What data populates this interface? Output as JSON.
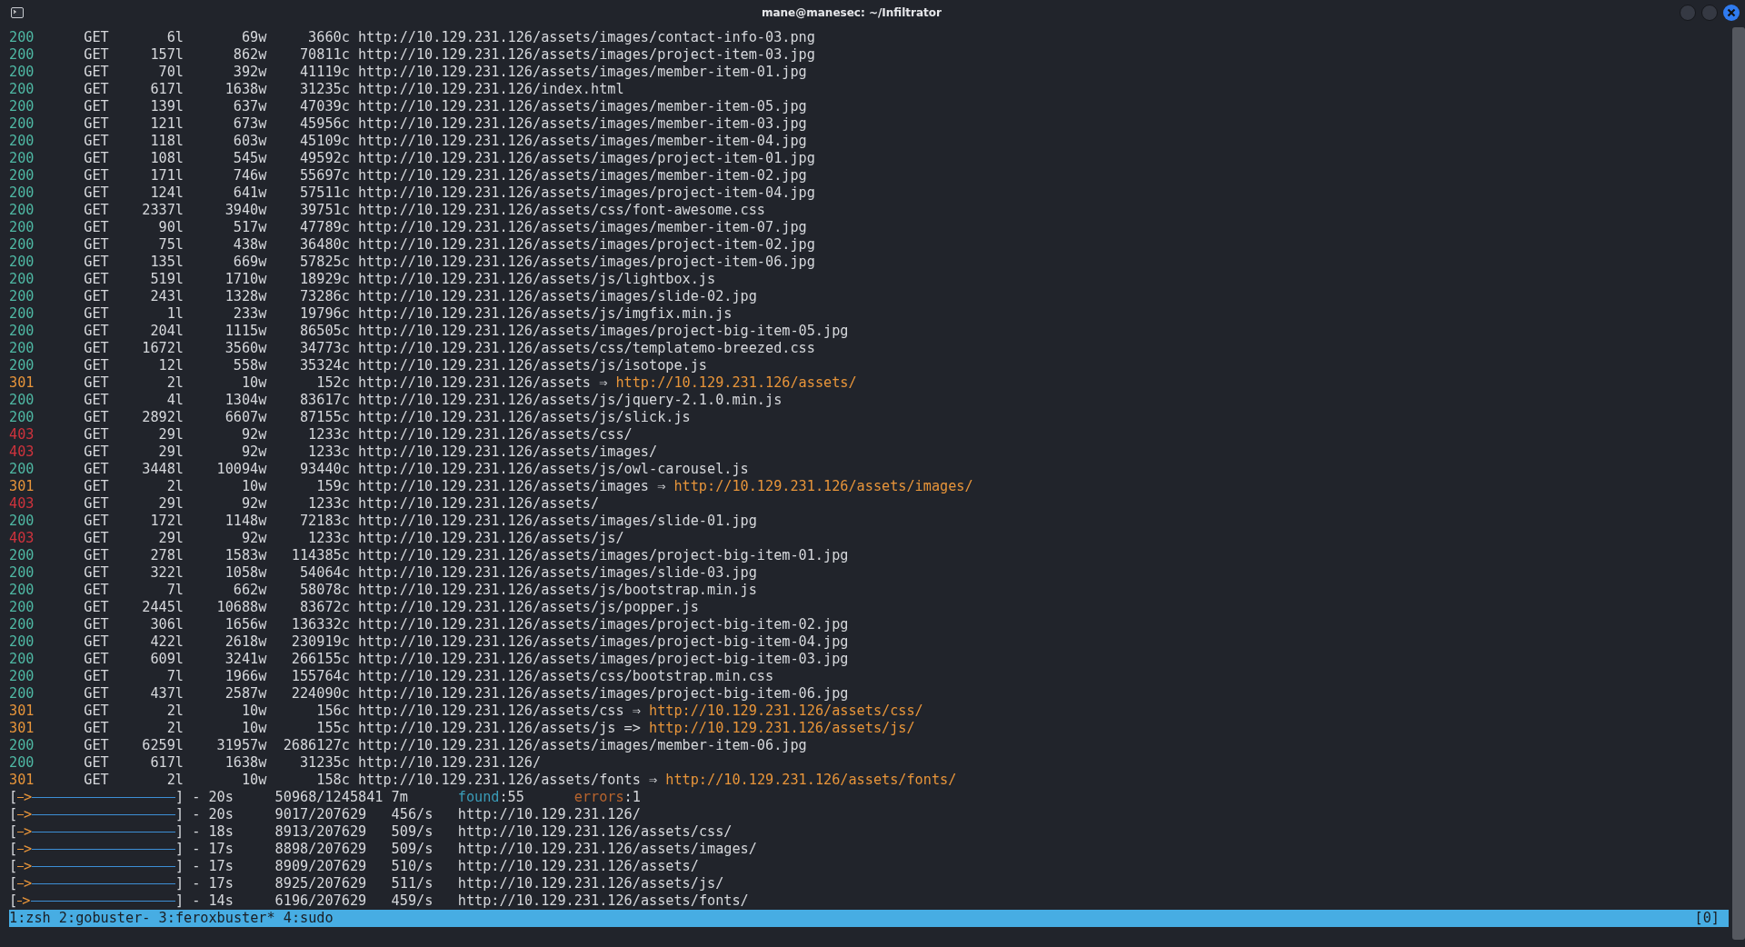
{
  "window": {
    "title": "mane@manesec: ~/Infiltrator"
  },
  "results": [
    {
      "kind": "ok",
      "status": "200",
      "method": "GET",
      "lines": "6l",
      "words": "69w",
      "chars": "3660c",
      "url": "http://10.129.231.126/assets/images/contact-info-03.png"
    },
    {
      "kind": "ok",
      "status": "200",
      "method": "GET",
      "lines": "157l",
      "words": "862w",
      "chars": "70811c",
      "url": "http://10.129.231.126/assets/images/project-item-03.jpg"
    },
    {
      "kind": "ok",
      "status": "200",
      "method": "GET",
      "lines": "70l",
      "words": "392w",
      "chars": "41119c",
      "url": "http://10.129.231.126/assets/images/member-item-01.jpg"
    },
    {
      "kind": "ok",
      "status": "200",
      "method": "GET",
      "lines": "617l",
      "words": "1638w",
      "chars": "31235c",
      "url": "http://10.129.231.126/index.html"
    },
    {
      "kind": "ok",
      "status": "200",
      "method": "GET",
      "lines": "139l",
      "words": "637w",
      "chars": "47039c",
      "url": "http://10.129.231.126/assets/images/member-item-05.jpg"
    },
    {
      "kind": "ok",
      "status": "200",
      "method": "GET",
      "lines": "121l",
      "words": "673w",
      "chars": "45956c",
      "url": "http://10.129.231.126/assets/images/member-item-03.jpg"
    },
    {
      "kind": "ok",
      "status": "200",
      "method": "GET",
      "lines": "118l",
      "words": "603w",
      "chars": "45109c",
      "url": "http://10.129.231.126/assets/images/member-item-04.jpg"
    },
    {
      "kind": "ok",
      "status": "200",
      "method": "GET",
      "lines": "108l",
      "words": "545w",
      "chars": "49592c",
      "url": "http://10.129.231.126/assets/images/project-item-01.jpg"
    },
    {
      "kind": "ok",
      "status": "200",
      "method": "GET",
      "lines": "171l",
      "words": "746w",
      "chars": "55697c",
      "url": "http://10.129.231.126/assets/images/member-item-02.jpg"
    },
    {
      "kind": "ok",
      "status": "200",
      "method": "GET",
      "lines": "124l",
      "words": "641w",
      "chars": "57511c",
      "url": "http://10.129.231.126/assets/images/project-item-04.jpg"
    },
    {
      "kind": "ok",
      "status": "200",
      "method": "GET",
      "lines": "2337l",
      "words": "3940w",
      "chars": "39751c",
      "url": "http://10.129.231.126/assets/css/font-awesome.css"
    },
    {
      "kind": "ok",
      "status": "200",
      "method": "GET",
      "lines": "90l",
      "words": "517w",
      "chars": "47789c",
      "url": "http://10.129.231.126/assets/images/member-item-07.jpg"
    },
    {
      "kind": "ok",
      "status": "200",
      "method": "GET",
      "lines": "75l",
      "words": "438w",
      "chars": "36480c",
      "url": "http://10.129.231.126/assets/images/project-item-02.jpg"
    },
    {
      "kind": "ok",
      "status": "200",
      "method": "GET",
      "lines": "135l",
      "words": "669w",
      "chars": "57825c",
      "url": "http://10.129.231.126/assets/images/project-item-06.jpg"
    },
    {
      "kind": "ok",
      "status": "200",
      "method": "GET",
      "lines": "519l",
      "words": "1710w",
      "chars": "18929c",
      "url": "http://10.129.231.126/assets/js/lightbox.js"
    },
    {
      "kind": "ok",
      "status": "200",
      "method": "GET",
      "lines": "243l",
      "words": "1328w",
      "chars": "73286c",
      "url": "http://10.129.231.126/assets/images/slide-02.jpg"
    },
    {
      "kind": "ok",
      "status": "200",
      "method": "GET",
      "lines": "1l",
      "words": "233w",
      "chars": "19796c",
      "url": "http://10.129.231.126/assets/js/imgfix.min.js"
    },
    {
      "kind": "ok",
      "status": "200",
      "method": "GET",
      "lines": "204l",
      "words": "1115w",
      "chars": "86505c",
      "url": "http://10.129.231.126/assets/images/project-big-item-05.jpg"
    },
    {
      "kind": "ok",
      "status": "200",
      "method": "GET",
      "lines": "1672l",
      "words": "3560w",
      "chars": "34773c",
      "url": "http://10.129.231.126/assets/css/templatemo-breezed.css"
    },
    {
      "kind": "ok",
      "status": "200",
      "method": "GET",
      "lines": "12l",
      "words": "558w",
      "chars": "35324c",
      "url": "http://10.129.231.126/assets/js/isotope.js"
    },
    {
      "kind": "redirect",
      "status": "301",
      "method": "GET",
      "lines": "2l",
      "words": "10w",
      "chars": "152c",
      "url": "http://10.129.231.126/assets",
      "arrow": "⇒",
      "redirect": "http://10.129.231.126/assets/"
    },
    {
      "kind": "ok",
      "status": "200",
      "method": "GET",
      "lines": "4l",
      "words": "1304w",
      "chars": "83617c",
      "url": "http://10.129.231.126/assets/js/jquery-2.1.0.min.js"
    },
    {
      "kind": "ok",
      "status": "200",
      "method": "GET",
      "lines": "2892l",
      "words": "6607w",
      "chars": "87155c",
      "url": "http://10.129.231.126/assets/js/slick.js"
    },
    {
      "kind": "forbidden",
      "status": "403",
      "method": "GET",
      "lines": "29l",
      "words": "92w",
      "chars": "1233c",
      "url": "http://10.129.231.126/assets/css/"
    },
    {
      "kind": "forbidden",
      "status": "403",
      "method": "GET",
      "lines": "29l",
      "words": "92w",
      "chars": "1233c",
      "url": "http://10.129.231.126/assets/images/"
    },
    {
      "kind": "ok",
      "status": "200",
      "method": "GET",
      "lines": "3448l",
      "words": "10094w",
      "chars": "93440c",
      "url": "http://10.129.231.126/assets/js/owl-carousel.js"
    },
    {
      "kind": "redirect",
      "status": "301",
      "method": "GET",
      "lines": "2l",
      "words": "10w",
      "chars": "159c",
      "url": "http://10.129.231.126/assets/images",
      "arrow": "⇒",
      "redirect": "http://10.129.231.126/assets/images/"
    },
    {
      "kind": "forbidden",
      "status": "403",
      "method": "GET",
      "lines": "29l",
      "words": "92w",
      "chars": "1233c",
      "url": "http://10.129.231.126/assets/"
    },
    {
      "kind": "ok",
      "status": "200",
      "method": "GET",
      "lines": "172l",
      "words": "1148w",
      "chars": "72183c",
      "url": "http://10.129.231.126/assets/images/slide-01.jpg"
    },
    {
      "kind": "forbidden",
      "status": "403",
      "method": "GET",
      "lines": "29l",
      "words": "92w",
      "chars": "1233c",
      "url": "http://10.129.231.126/assets/js/"
    },
    {
      "kind": "ok",
      "status": "200",
      "method": "GET",
      "lines": "278l",
      "words": "1583w",
      "chars": "114385c",
      "url": "http://10.129.231.126/assets/images/project-big-item-01.jpg"
    },
    {
      "kind": "ok",
      "status": "200",
      "method": "GET",
      "lines": "322l",
      "words": "1058w",
      "chars": "54064c",
      "url": "http://10.129.231.126/assets/images/slide-03.jpg"
    },
    {
      "kind": "ok",
      "status": "200",
      "method": "GET",
      "lines": "7l",
      "words": "662w",
      "chars": "58078c",
      "url": "http://10.129.231.126/assets/js/bootstrap.min.js"
    },
    {
      "kind": "ok",
      "status": "200",
      "method": "GET",
      "lines": "2445l",
      "words": "10688w",
      "chars": "83672c",
      "url": "http://10.129.231.126/assets/js/popper.js"
    },
    {
      "kind": "ok",
      "status": "200",
      "method": "GET",
      "lines": "306l",
      "words": "1656w",
      "chars": "136332c",
      "url": "http://10.129.231.126/assets/images/project-big-item-02.jpg"
    },
    {
      "kind": "ok",
      "status": "200",
      "method": "GET",
      "lines": "422l",
      "words": "2618w",
      "chars": "230919c",
      "url": "http://10.129.231.126/assets/images/project-big-item-04.jpg"
    },
    {
      "kind": "ok",
      "status": "200",
      "method": "GET",
      "lines": "609l",
      "words": "3241w",
      "chars": "266155c",
      "url": "http://10.129.231.126/assets/images/project-big-item-03.jpg"
    },
    {
      "kind": "ok",
      "status": "200",
      "method": "GET",
      "lines": "7l",
      "words": "1966w",
      "chars": "155764c",
      "url": "http://10.129.231.126/assets/css/bootstrap.min.css"
    },
    {
      "kind": "ok",
      "status": "200",
      "method": "GET",
      "lines": "437l",
      "words": "2587w",
      "chars": "224090c",
      "url": "http://10.129.231.126/assets/images/project-big-item-06.jpg"
    },
    {
      "kind": "redirect",
      "status": "301",
      "method": "GET",
      "lines": "2l",
      "words": "10w",
      "chars": "156c",
      "url": "http://10.129.231.126/assets/css",
      "arrow": "⇒",
      "redirect": "http://10.129.231.126/assets/css/"
    },
    {
      "kind": "redirect",
      "status": "301",
      "method": "GET",
      "lines": "2l",
      "words": "10w",
      "chars": "155c",
      "url": "http://10.129.231.126/assets/js",
      "arrow": "=>",
      "redirect": "http://10.129.231.126/assets/js/"
    },
    {
      "kind": "ok",
      "status": "200",
      "method": "GET",
      "lines": "6259l",
      "words": "31957w",
      "chars": "2686127c",
      "url": "http://10.129.231.126/assets/images/member-item-06.jpg"
    },
    {
      "kind": "ok",
      "status": "200",
      "method": "GET",
      "lines": "617l",
      "words": "1638w",
      "chars": "31235c",
      "url": "http://10.129.231.126/"
    },
    {
      "kind": "redirect",
      "status": "301",
      "method": "GET",
      "lines": "2l",
      "words": "10w",
      "chars": "158c",
      "url": "http://10.129.231.126/assets/fonts",
      "arrow": "⇒",
      "redirect": "http://10.129.231.126/assets/fonts/"
    }
  ],
  "progress": [
    {
      "kind": "total",
      "level": 0.04,
      "open": "[",
      "arrow": ">",
      "close": "]",
      "elapsed": "- 20s",
      "count": "50968/1245841",
      "rate": "7m",
      "found_label": "found",
      "found_value": ":55",
      "errors_label": "errors",
      "errors_value": ":1"
    },
    {
      "kind": "scan",
      "open": "[",
      "arrow": ">",
      "close": "]",
      "elapsed": "- 20s",
      "level": 0.04,
      "count": "9017/207629",
      "rate": "456/s",
      "url": "http://10.129.231.126/"
    },
    {
      "kind": "scan",
      "open": "[",
      "arrow": ">",
      "close": "]",
      "elapsed": "- 18s",
      "level": 0.04,
      "count": "8913/207629",
      "rate": "509/s",
      "url": "http://10.129.231.126/assets/css/"
    },
    {
      "kind": "scan",
      "open": "[",
      "arrow": ">",
      "close": "]",
      "elapsed": "- 17s",
      "level": 0.04,
      "count": "8898/207629",
      "rate": "509/s",
      "url": "http://10.129.231.126/assets/images/"
    },
    {
      "kind": "scan",
      "open": "[",
      "arrow": ">",
      "close": "]",
      "elapsed": "- 17s",
      "level": 0.04,
      "count": "8909/207629",
      "rate": "510/s",
      "url": "http://10.129.231.126/assets/"
    },
    {
      "kind": "scan",
      "open": "[",
      "arrow": ">",
      "close": "]",
      "elapsed": "- 17s",
      "level": 0.04,
      "count": "8925/207629",
      "rate": "511/s",
      "url": "http://10.129.231.126/assets/js/"
    },
    {
      "kind": "scan",
      "open": "[",
      "arrow": ">",
      "close": "]",
      "elapsed": "- 14s",
      "level": 0.03,
      "count": "6196/207629",
      "rate": "459/s",
      "url": "http://10.129.231.126/assets/fonts/"
    }
  ],
  "status_bar": {
    "windows": [
      "1:zsh",
      "2:gobuster-",
      "3:feroxbuster*",
      "4:sudo"
    ],
    "session": "[0]"
  }
}
